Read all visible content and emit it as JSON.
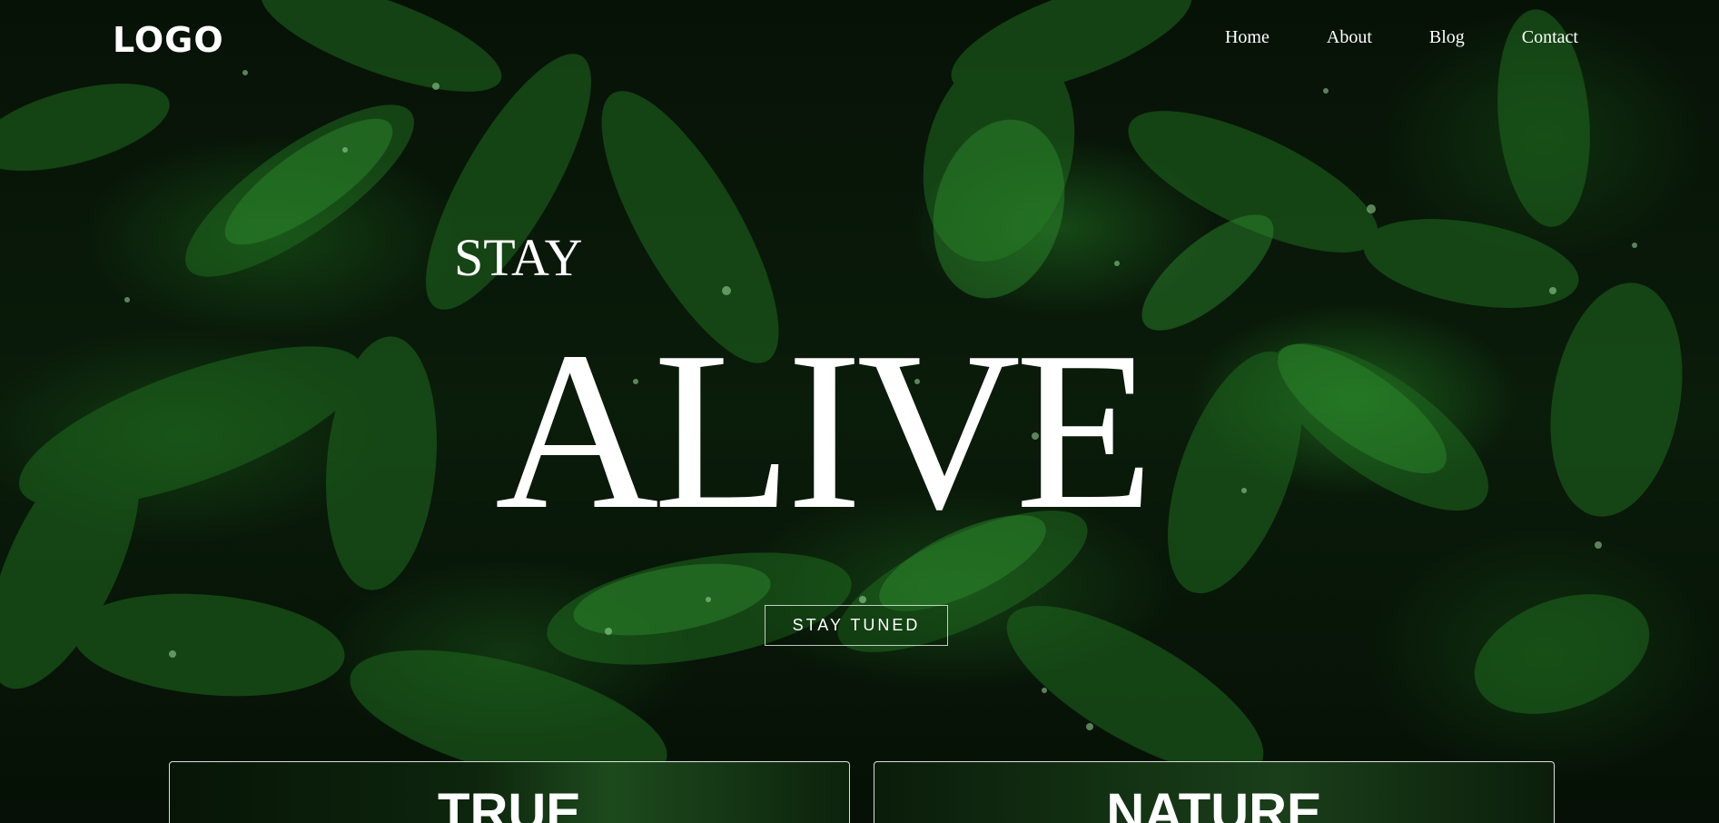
{
  "header": {
    "logo": "LOGO",
    "nav": [
      "Home",
      "About",
      "Blog",
      "Contact"
    ]
  },
  "hero": {
    "kicker": "STAY",
    "headline": "ALIVE",
    "cta_label": "STAY TUNED"
  },
  "cards": [
    {
      "title": "TRUE"
    },
    {
      "title": "NATURE"
    }
  ],
  "colors": {
    "text": "#ffffff",
    "background": "#061006",
    "leaf": "#2e8b2e"
  }
}
